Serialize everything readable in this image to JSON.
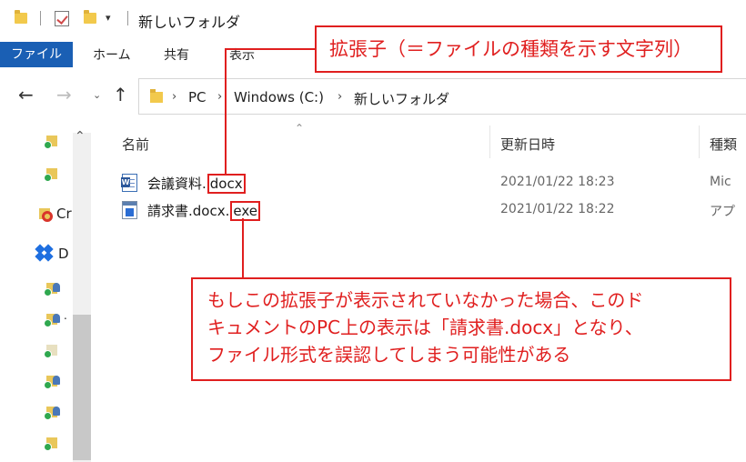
{
  "window": {
    "title": "新しいフォルダ",
    "qat_dropdown": "▾"
  },
  "ribbon": {
    "tabs": [
      "ファイル",
      "ホーム",
      "共有",
      "表示"
    ]
  },
  "address": {
    "back": "←",
    "forward": "→",
    "recent": "⌄",
    "up": "↑",
    "breadcrumbs": [
      "PC",
      "Windows (C:)",
      "新しいフォルダ"
    ],
    "separator": "›"
  },
  "navpane": {
    "truncated_labels": {
      "creative_cloud": "Cr",
      "dropbox": "D",
      "item3": "."
    }
  },
  "columns": {
    "name": "名前",
    "date": "更新日時",
    "type": "種類"
  },
  "files": [
    {
      "base": "会議資料.",
      "ext": "docx",
      "date": "2021/01/22 18:23",
      "type": "Mic",
      "icon": "word-document-icon"
    },
    {
      "base": "請求書.docx.",
      "ext": "exe",
      "date": "2021/01/22 18:22",
      "type": "アプ",
      "icon": "application-icon"
    }
  ],
  "callouts": {
    "top": "拡張子（＝ファイルの種類を示す文字列）",
    "bottom": [
      "もしこの拡張子が表示されていなかった場合、このド",
      "キュメントのPC上の表示は「請求書.docx」となり、",
      "ファイル形式を誤認してしまう可能性がある"
    ]
  },
  "colors": {
    "accent_red": "#e01f1f",
    "file_tab_blue": "#1a5fb4",
    "folder_yellow": "#f2c94c"
  }
}
